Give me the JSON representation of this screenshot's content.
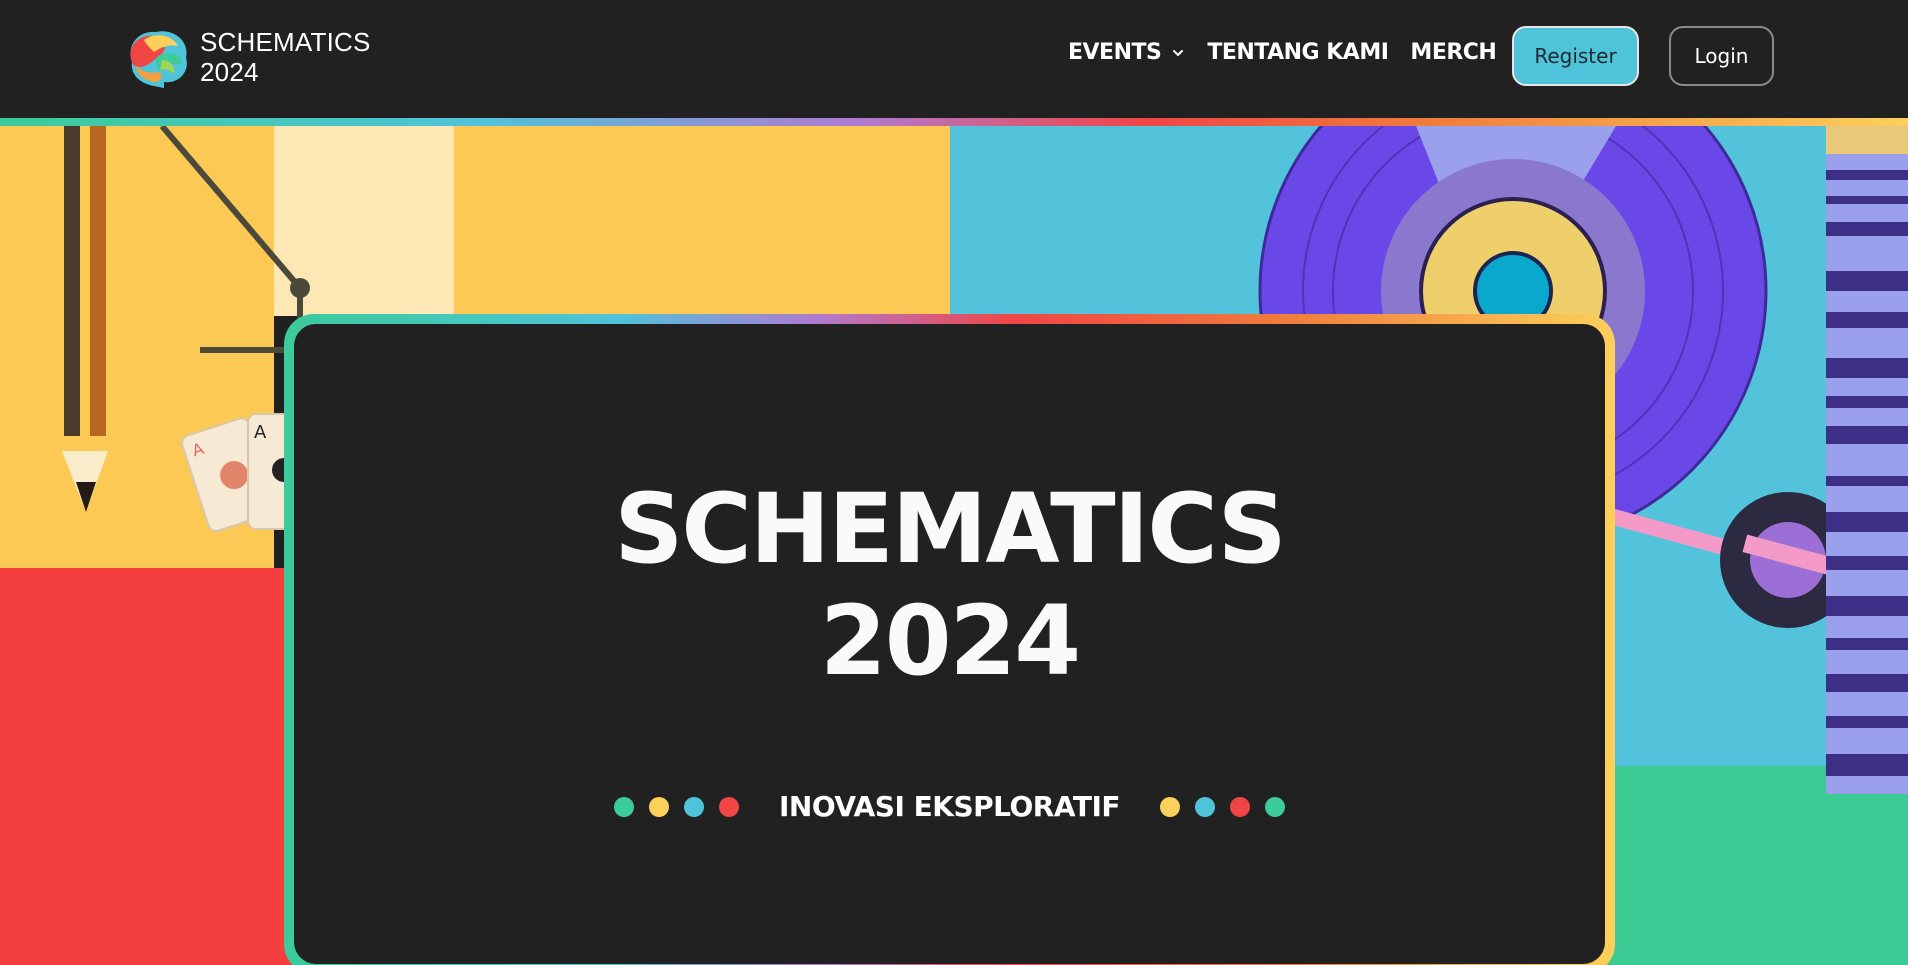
{
  "header": {
    "logo_line1": "SCHEMATICS",
    "logo_line2": "2024",
    "nav": {
      "events_label": "EVENTS",
      "about_label": "TENTANG KAMI",
      "merch_label": "MERCH"
    },
    "register_label": "Register",
    "login_label": "Login"
  },
  "hero": {
    "title_line1": "SCHEMATICS",
    "title_line2": "2024",
    "tagline": "INOVASI EKSPLORATIF",
    "left_dot_colors": [
      "#3ccb9a",
      "#fcd05a",
      "#4fc3da",
      "#f04545"
    ],
    "right_dot_colors": [
      "#fcd05a",
      "#4fc3da",
      "#f04545",
      "#3ccb9a"
    ]
  },
  "colors": {
    "background": "#212121",
    "accent_blue": "#4fc3da",
    "accent_yellow": "#fcd05a",
    "accent_red": "#f04545",
    "accent_green": "#3ccb9a",
    "accent_purple": "#6a48e8"
  }
}
